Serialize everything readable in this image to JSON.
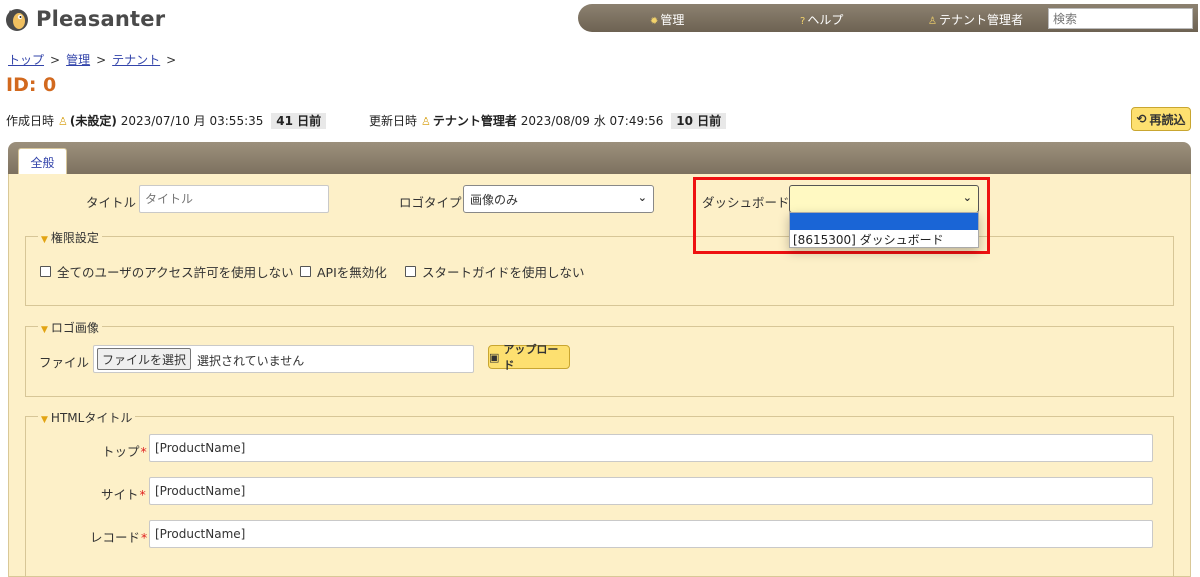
{
  "header": {
    "logo_text": "Pleasanter",
    "nav": [
      {
        "icon": "gear-icon",
        "glyph": "✹",
        "label": "管理"
      },
      {
        "icon": "help-icon",
        "glyph": "?",
        "label": "ヘルプ"
      },
      {
        "icon": "user-icon",
        "glyph": "♙",
        "label": "テナント管理者"
      }
    ],
    "search_placeholder": "検索"
  },
  "breadcrumb": [
    "トップ",
    "管理",
    "テナント"
  ],
  "breadcrumb_sep": ">",
  "page_title": "ID: 0",
  "meta": {
    "created_label": "作成日時",
    "created_user": "(未設定)",
    "created_date": "2023/07/10 月 03:55:35",
    "created_ago": "41 日前",
    "updated_label": "更新日時",
    "updated_user": "テナント管理者",
    "updated_date": "2023/08/09 水 07:49:56",
    "updated_ago": "10 日前"
  },
  "reload_label": "再読込",
  "tabs": [
    "全般"
  ],
  "form": {
    "title_label": "タイトル",
    "title_placeholder": "タイトル",
    "logo_type_label": "ロゴタイプ",
    "logo_type_value": "画像のみ",
    "dashboard_label": "ダッシュボード",
    "dashboard_value": "",
    "dashboard_options": [
      "",
      "[8615300] ダッシュボード"
    ]
  },
  "permissions": {
    "legend": "権限設定",
    "checkboxes": [
      "全てのユーザのアクセス許可を使用しない",
      "APIを無効化",
      "スタートガイドを使用しない"
    ]
  },
  "logo_image": {
    "legend": "ロゴ画像",
    "file_label": "ファイル",
    "file_button": "ファイルを選択",
    "file_status": "選択されていません",
    "upload_label": "アップロード"
  },
  "html_title": {
    "legend": "HTMLタイトル",
    "rows": [
      {
        "label": "トップ",
        "value": "[ProductName]"
      },
      {
        "label": "サイト",
        "value": "[ProductName]"
      },
      {
        "label": "レコード",
        "value": "[ProductName]"
      }
    ],
    "required_mark": "*"
  }
}
